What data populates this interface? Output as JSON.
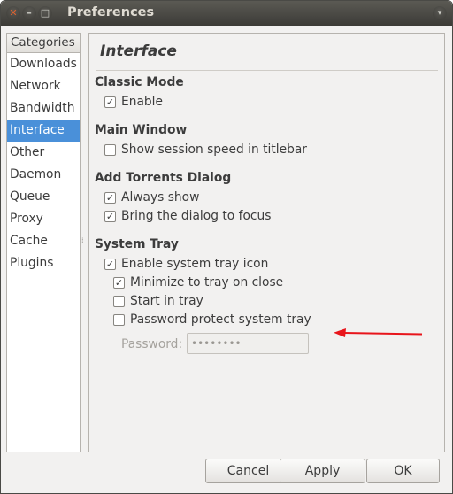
{
  "window": {
    "title": "Preferences",
    "close_glyph": "✕",
    "min_glyph": "–",
    "max_glyph": "□",
    "menu_glyph": "▾"
  },
  "categories": {
    "header": "Categories",
    "items": [
      "Downloads",
      "Network",
      "Bandwidth",
      "Interface",
      "Other",
      "Daemon",
      "Queue",
      "Proxy",
      "Cache",
      "Plugins"
    ],
    "selected": "Interface"
  },
  "page": {
    "title": "Interface",
    "classic_mode": {
      "heading": "Classic Mode",
      "enable": {
        "label": "Enable",
        "checked": true
      }
    },
    "main_window": {
      "heading": "Main Window",
      "show_speed": {
        "label": "Show session speed in titlebar",
        "checked": false
      }
    },
    "add_torrents": {
      "heading": "Add Torrents Dialog",
      "always_show": {
        "label": "Always show",
        "checked": true
      },
      "focus": {
        "label": "Bring the dialog to focus",
        "checked": true
      }
    },
    "system_tray": {
      "heading": "System Tray",
      "enable_icon": {
        "label": "Enable system tray icon",
        "checked": true
      },
      "minimize": {
        "label": "Minimize to tray on close",
        "checked": true
      },
      "start_in_tray": {
        "label": "Start in tray",
        "checked": false
      },
      "password_protect": {
        "label": "Password protect system tray",
        "checked": false
      },
      "password_label": "Password:",
      "password_value": "••••••••"
    }
  },
  "buttons": {
    "cancel": "Cancel",
    "apply": "Apply",
    "ok": "OK"
  },
  "colors": {
    "selection": "#4a90d9",
    "titlebar": "#3c3b37",
    "annotation_arrow": "#e8151b"
  },
  "check_glyph": "✓"
}
